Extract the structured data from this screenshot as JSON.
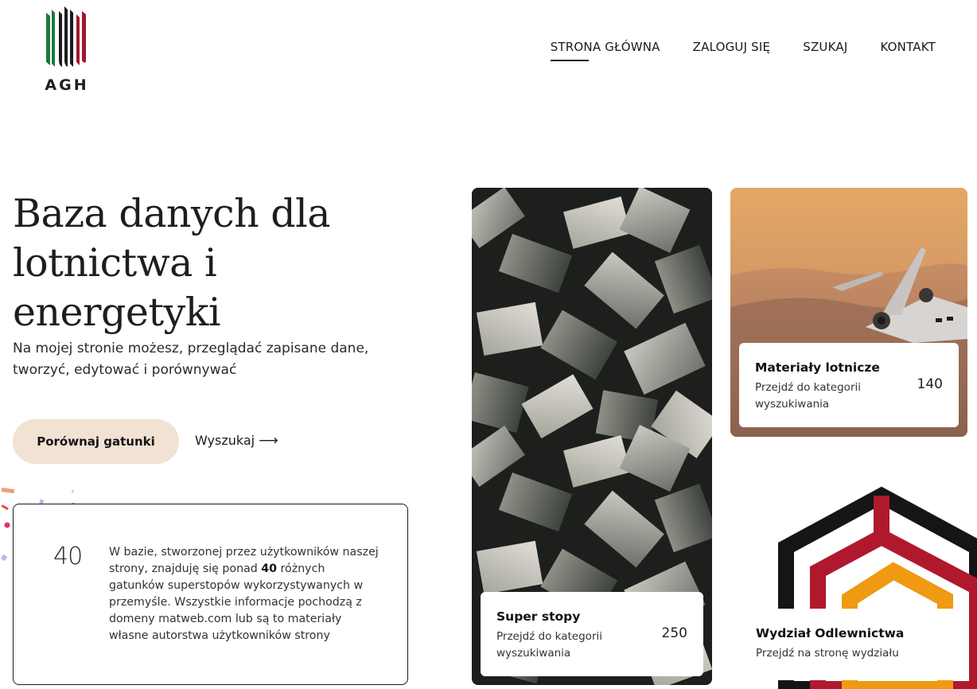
{
  "header": {
    "logo_text": "AGH",
    "nav": [
      {
        "label": "STRONA GŁÓWNA",
        "active": true
      },
      {
        "label": "ZALOGUJ SIĘ",
        "active": false
      },
      {
        "label": "SZUKAJ",
        "active": false
      },
      {
        "label": "KONTAKT",
        "active": false
      }
    ]
  },
  "hero": {
    "title_lines": [
      "Baza danych dla",
      "lotnictwa i",
      "energetyki"
    ],
    "subtitle_lines": [
      "Na mojej stronie możesz, przeglądać zapisane dane,",
      "tworzyć, edytować i porównywać"
    ],
    "primary_button": "Porównaj gatunki",
    "secondary_link": "Wyszukaj",
    "secondary_link_arrow": "⟶"
  },
  "info": {
    "number": "40",
    "text_before": "W bazie, stworzonej przez użytkowników naszej strony, znajduję się ponad ",
    "text_bold": "40",
    "text_after": " różnych gatunków superstopów wykorzystywanych w przemyśle. Wszystkie informacje pochodzą z domeny matweb.com lub są to materiały własne autorstwa użytkowników strony"
  },
  "tiles": {
    "metal": {
      "title": "Super stopy",
      "subtitle": "Przejdź do kategorii wyszukiwania",
      "count": "250"
    },
    "plane": {
      "title": "Materiały lotnicze",
      "subtitle": "Przejdź do kategorii wyszukiwania",
      "count": "140"
    },
    "faculty": {
      "title": "Wydział Odlewnictwa",
      "subtitle": "Przejdź na stronę wydziału"
    }
  },
  "colors": {
    "agh_green": "#1d7a3c",
    "agh_black": "#1c1c1c",
    "agh_red": "#a3162b",
    "button_bg": "#f1e2d4",
    "hex_orange": "#ef9a12",
    "hex_red": "#b0182e"
  }
}
